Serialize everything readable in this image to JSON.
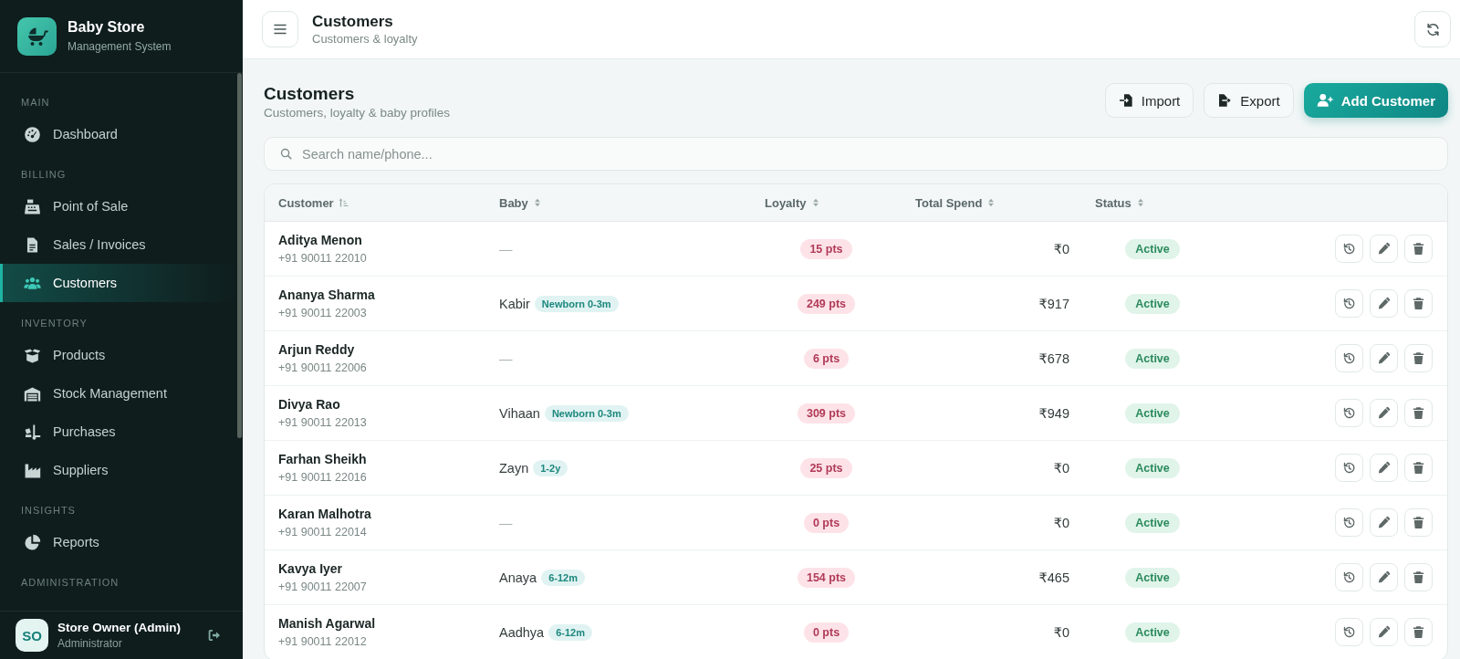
{
  "sidebar": {
    "brand": {
      "name": "Baby Store",
      "tagline": "Management System"
    },
    "sections": [
      {
        "label": "MAIN",
        "items": [
          {
            "label": "Dashboard",
            "selected": false
          }
        ]
      },
      {
        "label": "BILLING",
        "items": [
          {
            "label": "Point of Sale",
            "selected": false
          },
          {
            "label": "Sales / Invoices",
            "selected": false
          },
          {
            "label": "Customers",
            "selected": true
          }
        ]
      },
      {
        "label": "INVENTORY",
        "items": [
          {
            "label": "Products",
            "selected": false
          },
          {
            "label": "Stock Management",
            "selected": false
          },
          {
            "label": "Purchases",
            "selected": false
          },
          {
            "label": "Suppliers",
            "selected": false
          }
        ]
      },
      {
        "label": "INSIGHTS",
        "items": [
          {
            "label": "Reports",
            "selected": false
          }
        ]
      },
      {
        "label": "ADMINISTRATION"
      }
    ],
    "user": {
      "initials": "SO",
      "name": "Store Owner (Admin)",
      "role": "Administrator"
    }
  },
  "topbar": {
    "title": "Customers",
    "subtitle": "Customers & loyalty"
  },
  "page": {
    "title": "Customers",
    "subtitle": "Customers, loyalty & baby profiles",
    "actions": [
      {
        "label": "Import",
        "kind": "secondary"
      },
      {
        "label": "Export",
        "kind": "secondary"
      },
      {
        "label": "Add Customer",
        "kind": "primary"
      }
    ]
  },
  "search": {
    "placeholder": "Search name/phone..."
  },
  "table": {
    "columns": [
      {
        "label": "Customer",
        "sorted": true
      },
      {
        "label": "Baby",
        "sorted": false
      },
      {
        "label": "Loyalty",
        "sorted": false
      },
      {
        "label": "Total Spend",
        "sorted": false
      },
      {
        "label": "Status",
        "sorted": false
      }
    ],
    "rows": [
      {
        "name": "Aditya Menon",
        "phone": "+91 90011 22010",
        "baby": {
          "kind": "none",
          "name": "—"
        },
        "loyalty": "15 pts",
        "total_spend": "₹0",
        "status": "Active"
      },
      {
        "name": "Ananya Sharma",
        "phone": "+91 90011 22003",
        "baby": {
          "kind": "profile",
          "name": "Kabir",
          "stage": "Newborn 0-3m"
        },
        "loyalty": "249 pts",
        "total_spend": "₹917",
        "status": "Active"
      },
      {
        "name": "Arjun Reddy",
        "phone": "+91 90011 22006",
        "baby": {
          "kind": "none",
          "name": "—"
        },
        "loyalty": "6 pts",
        "total_spend": "₹678",
        "status": "Active"
      },
      {
        "name": "Divya Rao",
        "phone": "+91 90011 22013",
        "baby": {
          "kind": "profile",
          "name": "Vihaan",
          "stage": "Newborn 0-3m"
        },
        "loyalty": "309 pts",
        "total_spend": "₹949",
        "status": "Active"
      },
      {
        "name": "Farhan Sheikh",
        "phone": "+91 90011 22016",
        "baby": {
          "kind": "profile",
          "name": "Zayn",
          "stage": "1-2y"
        },
        "loyalty": "25 pts",
        "total_spend": "₹0",
        "status": "Active"
      },
      {
        "name": "Karan Malhotra",
        "phone": "+91 90011 22014",
        "baby": {
          "kind": "none",
          "name": "—"
        },
        "loyalty": "0 pts",
        "total_spend": "₹0",
        "status": "Active"
      },
      {
        "name": "Kavya Iyer",
        "phone": "+91 90011 22007",
        "baby": {
          "kind": "profile",
          "name": "Anaya",
          "stage": "6-12m"
        },
        "loyalty": "154 pts",
        "total_spend": "₹465",
        "status": "Active"
      },
      {
        "name": "Manish Agarwal",
        "phone": "+91 90011 22012",
        "baby": {
          "kind": "profile",
          "name": "Aadhya",
          "stage": "6-12m"
        },
        "loyalty": "0 pts",
        "total_spend": "₹0",
        "status": "Active"
      }
    ]
  }
}
